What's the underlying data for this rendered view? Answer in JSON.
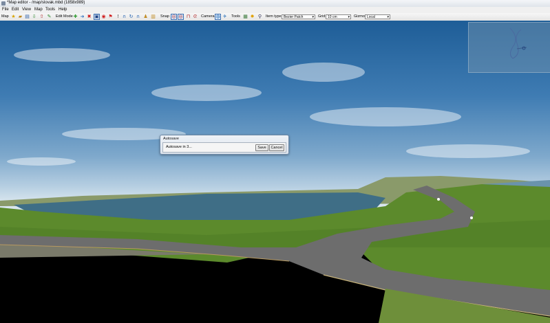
{
  "window": {
    "title": "*Map editor - /map/slovak.mbd (1858x989)"
  },
  "menu": [
    "File",
    "Edit",
    "View",
    "Map",
    "Tools",
    "Help"
  ],
  "toolbar": {
    "map_label": "Map",
    "edit_mode_label": "Edit Mode",
    "snap_label": "Snap",
    "camera_label": "Camera",
    "tools_label": "Tools",
    "item_type_label": "Item type",
    "item_type_value": "Bezier Patch",
    "grid_label": "Grid",
    "grid_value": "10 cm",
    "gizmo_label": "Gizmo",
    "gizmo_value": "Local"
  },
  "icons": {
    "map": [
      "new-icon",
      "open-icon",
      "save-icon",
      "export-icon",
      "import-icon",
      "edit-icon"
    ],
    "edit": [
      "add-icon",
      "move-icon",
      "delete-icon",
      "select-icon",
      "clock-icon",
      "flag-icon",
      "pin-icon",
      "magnet-icon",
      "rotate-icon",
      "lock-icon",
      "stamp-icon",
      "grid-icon"
    ],
    "snap": [
      "snap-node-icon",
      "snap-point-icon",
      "snap-terrain-icon",
      "snap-item-icon"
    ],
    "camera": [
      "camera-orbit-icon",
      "camera-fly-icon"
    ],
    "tools": [
      "palette-icon",
      "light-icon",
      "search-icon"
    ]
  },
  "dialog": {
    "title": "Autosave",
    "message": "Autosave in 3...",
    "save": "Save",
    "cancel": "Cancel"
  }
}
